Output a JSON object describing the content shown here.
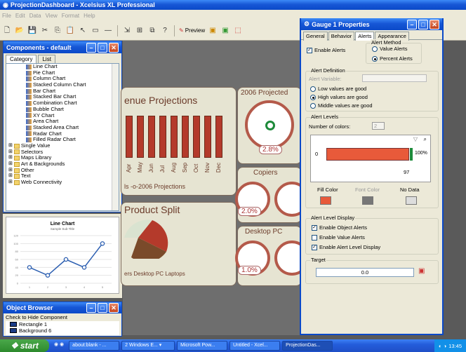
{
  "app_title": "ProjectionDashboard - Xcelsius XL Professional",
  "menu": [
    "File",
    "Edit",
    "Data",
    "View",
    "Format",
    "Help"
  ],
  "toolbar": {
    "preview_label": "Preview"
  },
  "components_panel": {
    "title": "Components - default",
    "tabs": [
      "Category",
      "List"
    ],
    "tree_items": [
      "Line Chart",
      "Pie Chart",
      "Column Chart",
      "Stacked Column Chart",
      "Bar Chart",
      "Stacked Bar Chart",
      "Combination Chart",
      "Bubble Chart",
      "XY Chart",
      "Area Chart",
      "Stacked Area Chart",
      "Radar Chart",
      "Filled Radar Chart"
    ],
    "folders": [
      "Single Value",
      "Selectors",
      "Maps Library",
      "Art & Backgrounds",
      "Other",
      "Text",
      "Web Connectivity"
    ]
  },
  "preview_chart": {
    "title": "Line Chart",
    "subtitle": "Sample Sub-Title"
  },
  "chart_data": {
    "type": "line",
    "title": "Line Chart",
    "subtitle": "Sample Sub-Title",
    "x": [
      1,
      2,
      3,
      4,
      5
    ],
    "values": [
      40,
      20,
      60,
      40,
      100
    ],
    "ylim": [
      0,
      120
    ],
    "yticks": [
      0,
      20,
      40,
      60,
      80,
      100,
      120
    ]
  },
  "object_browser": {
    "title": "Object Browser",
    "hint": "Check to Hide Component",
    "items": [
      "Rectangle 1",
      "Background 6"
    ]
  },
  "dashboard": {
    "revenue_title": "enue Projections",
    "months": [
      "Apr",
      "May",
      "Jun",
      "Jul",
      "Aug",
      "Sep",
      "Oct",
      "Nov",
      "Dec"
    ],
    "legend": "ls  -o-2006 Projections",
    "split_title": "Product Split",
    "split_legend": "ers  Desktop PC  Laptops",
    "proj_title": "2006 Projected",
    "gauge1_value": "2.8%",
    "copiers_label": "Copiers",
    "gauge2_value": "2.0%",
    "desktop_label": "Desktop PC",
    "gauge3_value": "1.0%"
  },
  "props": {
    "title": "Gauge 1 Properties",
    "tabs": [
      "General",
      "Behavior",
      "Alerts",
      "Appearance"
    ],
    "enable_alerts": "Enable Alerts",
    "alert_method": "Alert Method",
    "value_alerts": "Value Alerts",
    "percent_alerts": "Percent Alerts",
    "alert_definition": "Alert Definition",
    "alert_variable": "Alert Variable:",
    "low_good": "Low values are good",
    "high_good": "High values are good",
    "middle_good": "Middle values are good",
    "alert_levels": "Alert Levels",
    "num_colors": "Number of colors:",
    "num_colors_value": "2",
    "min_value": "0",
    "max_label": "100%",
    "threshold": "97",
    "fill_color": "Fill Color",
    "font_color": "Font Color",
    "no_data": "No Data",
    "display_group": "Alert Level Display",
    "enable_object_alerts": "Enable Object Alerts",
    "enable_value_alerts": "Enable Value Alerts",
    "enable_level_display": "Enable Alert Level Display",
    "target_group": "Target",
    "target_value": "0.0"
  },
  "taskbar": {
    "start": "start",
    "tasks": [
      "about:blank - ...",
      "2 Windows E... ▾",
      "Microsoft Pow...",
      "Untitled - Xcel...",
      "ProjectionDas..."
    ],
    "clock": "13:45"
  },
  "colors": {
    "xp_blue": "#0b49c8",
    "alert_red": "#e85a3a",
    "alert_green": "#1d8a3a",
    "accent_brown": "#6b3b2a"
  }
}
